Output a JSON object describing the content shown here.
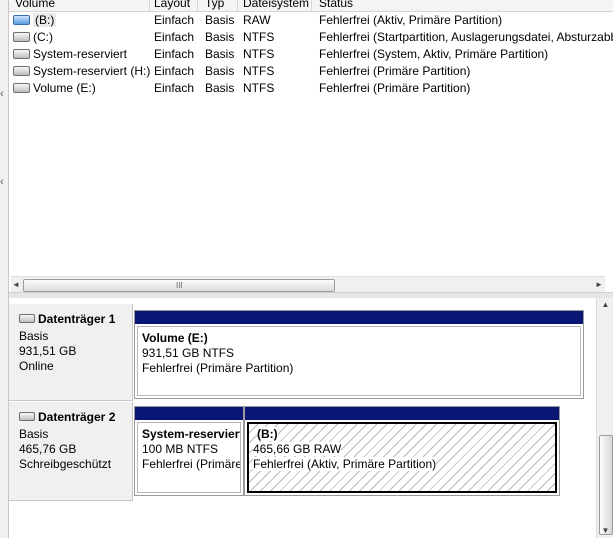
{
  "columns": [
    "Volume",
    "Layout",
    "Typ",
    "Dateisystem",
    "Status"
  ],
  "volumes": [
    {
      "name": "(B:)",
      "layout": "Einfach",
      "typ": "Basis",
      "fs": "RAW",
      "status": "Fehlerfrei (Aktiv, Primäre Partition)",
      "icon": "removable-drive-icon"
    },
    {
      "name": "(C:)",
      "layout": "Einfach",
      "typ": "Basis",
      "fs": "NTFS",
      "status": "Fehlerfrei (Startpartition, Auslagerungsdatei, Absturzabbild",
      "icon": "drive-icon"
    },
    {
      "name": "System-reserviert",
      "layout": "Einfach",
      "typ": "Basis",
      "fs": "NTFS",
      "status": "Fehlerfrei (System, Aktiv, Primäre Partition)",
      "icon": "drive-icon"
    },
    {
      "name": "System-reserviert (H:)",
      "layout": "Einfach",
      "typ": "Basis",
      "fs": "NTFS",
      "status": "Fehlerfrei (Primäre Partition)",
      "icon": "drive-icon"
    },
    {
      "name": "Volume (E:)",
      "layout": "Einfach",
      "typ": "Basis",
      "fs": "NTFS",
      "status": "Fehlerfrei (Primäre Partition)",
      "icon": "drive-icon"
    }
  ],
  "scroll": {
    "grip": "III",
    "left_arrow": "◄",
    "right_arrow": "►",
    "up_arrow": "▲",
    "down_arrow": "▼"
  },
  "disks": [
    {
      "name": "Datenträger 1",
      "type": "Basis",
      "size": "931,51 GB",
      "state": "Online",
      "partitions": [
        {
          "label": "Volume  (E:)",
          "size": "931,51 GB NTFS",
          "status": "Fehlerfrei (Primäre Partition)"
        }
      ]
    },
    {
      "name": "Datenträger 2",
      "type": "Basis",
      "size": "465,76 GB",
      "state": "Schreibgeschützt",
      "partitions": [
        {
          "label": "System-reserviert",
          "size": "100 MB NTFS",
          "status": "Fehlerfrei (Primäre Partition)"
        },
        {
          "label": "(B:)",
          "size": "465,66 GB RAW",
          "status": "Fehlerfrei (Aktiv, Primäre Partition)"
        }
      ]
    }
  ],
  "colors": {
    "partition_bar": "#0a1676",
    "background": "#f0f0f0"
  }
}
